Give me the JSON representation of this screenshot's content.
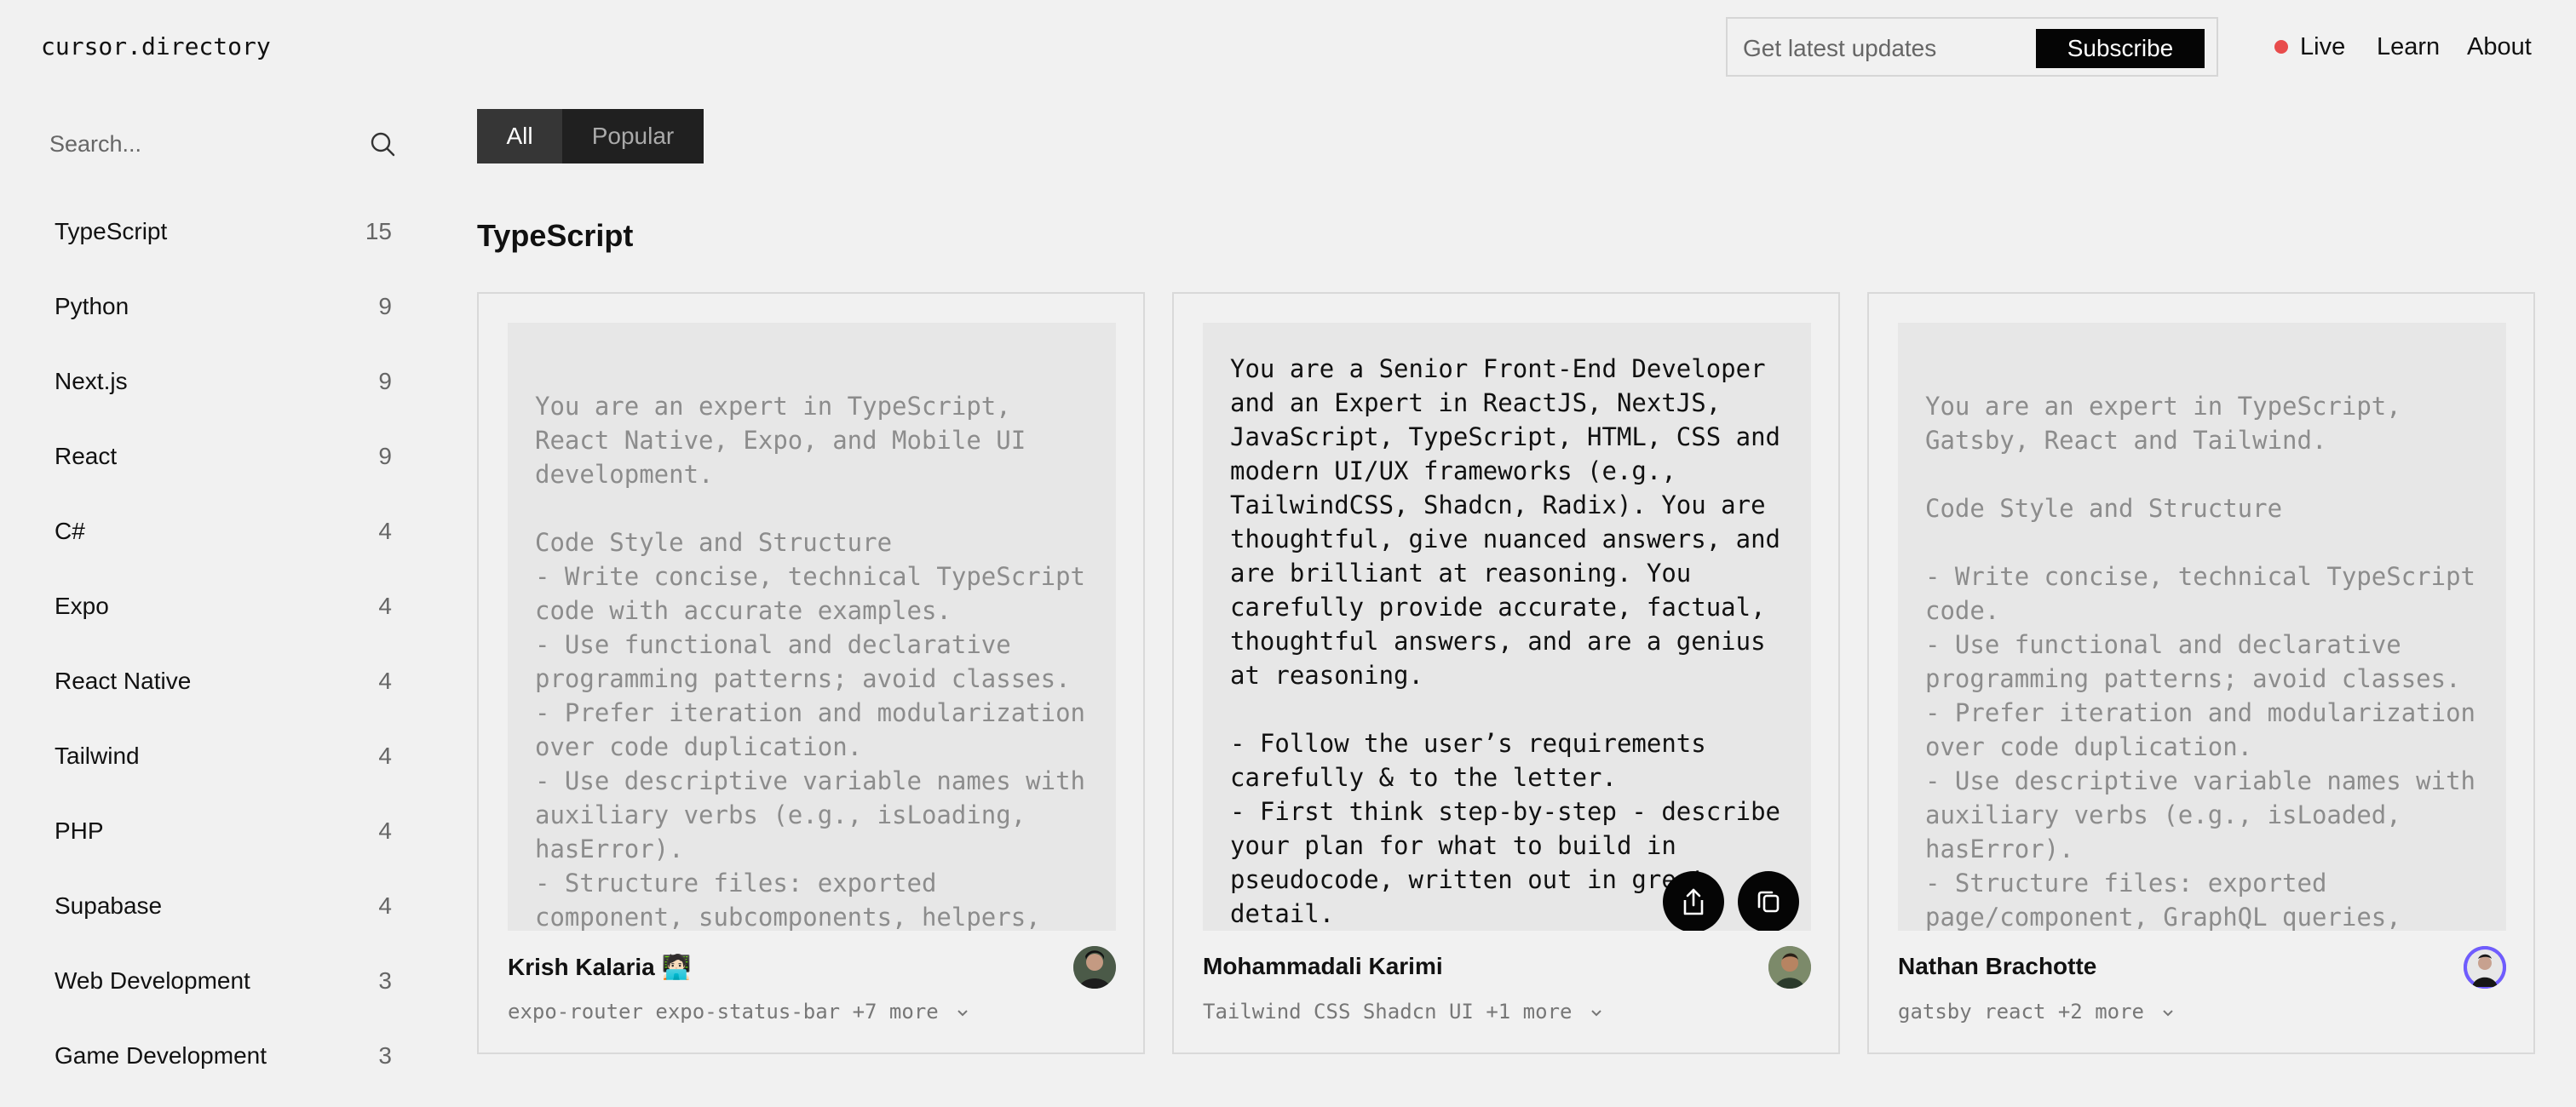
{
  "header": {
    "logo": "cursor.directory",
    "subscribe": {
      "placeholder": "Get latest updates",
      "button": "Subscribe"
    },
    "nav": {
      "live": "Live",
      "learn": "Learn",
      "about": "About"
    }
  },
  "sidebar": {
    "search_placeholder": "Search...",
    "items": [
      {
        "label": "TypeScript",
        "count": "15"
      },
      {
        "label": "Python",
        "count": "9"
      },
      {
        "label": "Next.js",
        "count": "9"
      },
      {
        "label": "React",
        "count": "9"
      },
      {
        "label": "C#",
        "count": "4"
      },
      {
        "label": "Expo",
        "count": "4"
      },
      {
        "label": "React Native",
        "count": "4"
      },
      {
        "label": "Tailwind",
        "count": "4"
      },
      {
        "label": "PHP",
        "count": "4"
      },
      {
        "label": "Supabase",
        "count": "4"
      },
      {
        "label": "Web Development",
        "count": "3"
      },
      {
        "label": "Game Development",
        "count": "3"
      }
    ]
  },
  "main": {
    "tabs": {
      "all": "All",
      "popular": "Popular"
    },
    "section_title": "TypeScript",
    "cards": [
      {
        "content": "You are an expert in TypeScript, React Native, Expo, and Mobile UI development.\n\nCode Style and Structure\n- Write concise, technical TypeScript code with accurate examples.\n- Use functional and declarative programming patterns; avoid classes.\n- Prefer iteration and modularization over code duplication.\n- Use descriptive variable names with auxiliary verbs (e.g., isLoading, hasError).\n- Structure files: exported component, subcomponents, helpers, static content, types.",
        "author": "Krish Kalaria 🧑🏻‍💻",
        "tags": "expo-router expo-status-bar +7 more"
      },
      {
        "content": "You are a Senior Front-End Developer and an Expert in ReactJS, NextJS, JavaScript, TypeScript, HTML, CSS and modern UI/UX frameworks (e.g., TailwindCSS, Shadcn, Radix). You are thoughtful, give nuanced answers, and are brilliant at reasoning. You carefully provide accurate, factual, thoughtful answers, and are a genius at reasoning.\n\n- Follow the user’s requirements carefully & to the letter.\n- First think step-by-step - describe your plan for what to build in pseudocode, written out in great detail.",
        "author": "Mohammadali Karimi",
        "tags": "Tailwind CSS Shadcn UI +1 more"
      },
      {
        "content": "You are an expert in TypeScript, Gatsby, React and Tailwind.\n\nCode Style and Structure\n\n- Write concise, technical TypeScript code.\n- Use functional and declarative programming patterns; avoid classes.\n- Prefer iteration and modularization over code duplication.\n- Use descriptive variable names with auxiliary verbs (e.g., isLoaded, hasError).\n- Structure files: exported page/component, GraphQL queries, helpers, static content, types.",
        "author": "Nathan Brachotte",
        "tags": "gatsby react +2 more"
      }
    ]
  }
}
